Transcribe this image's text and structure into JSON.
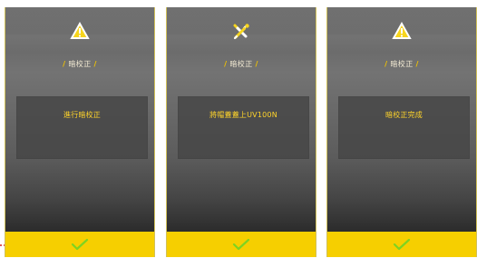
{
  "screens": [
    {
      "title_left": "/",
      "title": "暗校正",
      "title_right": "/",
      "message": "進行暗校正",
      "icon": "warning-triangle-icon",
      "button_icon": "checkmark-icon"
    },
    {
      "title_left": "/",
      "title": "暗校正",
      "title_right": "/",
      "message": "將帽蓋蓋上UV100N",
      "icon": "tools-icon",
      "button_icon": "checkmark-icon"
    },
    {
      "title_left": "/",
      "title": "暗校正",
      "title_right": "/",
      "message": "暗校正完成",
      "icon": "warning-triangle-icon",
      "button_icon": "checkmark-icon"
    }
  ],
  "colors": {
    "accent": "#f6cf00",
    "text_gold": "#ffd42a",
    "pointer_red": "#d62020"
  },
  "pointer": {
    "icon": "dashed-arrow-icon"
  }
}
